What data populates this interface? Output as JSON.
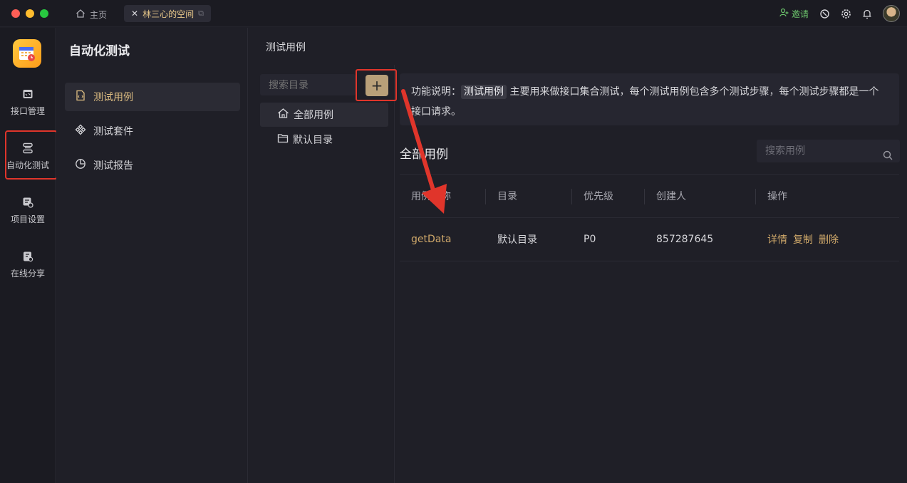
{
  "titlebar": {
    "home_tab": "主页",
    "active_tab": "林三心的空间",
    "invite_label": "邀请",
    "accent": "#e8c88a",
    "invite_color": "#6cc46c"
  },
  "rail": {
    "items": [
      {
        "label": "接口管理",
        "icon": "api-icon"
      },
      {
        "label": "自动化测试",
        "icon": "automation-icon"
      },
      {
        "label": "项目设置",
        "icon": "project-settings-icon"
      },
      {
        "label": "在线分享",
        "icon": "share-icon"
      }
    ]
  },
  "sidebar": {
    "title": "自动化测试",
    "items": [
      {
        "label": "测试用例",
        "icon": "test-case-icon"
      },
      {
        "label": "测试套件",
        "icon": "test-suite-icon"
      },
      {
        "label": "测试报告",
        "icon": "test-report-icon"
      }
    ]
  },
  "main": {
    "breadcrumb": "测试用例",
    "dir_search_placeholder": "搜索目录",
    "add_label": "+",
    "dirs": [
      {
        "label": "全部用例",
        "icon": "home-icon"
      },
      {
        "label": "默认目录",
        "icon": "folder-icon"
      }
    ],
    "note": {
      "prefix": "功能说明：",
      "tag": "测试用例",
      "text": " 主要用来做接口集合测试，每个测试用例包含多个测试步骤，每个测试步骤都是一个接口请求。"
    },
    "list_title": "全部用例",
    "case_search_placeholder": "搜索用例",
    "table": {
      "headers": [
        "用例名称",
        "目录",
        "优先级",
        "创建人",
        "操作"
      ],
      "rows": [
        {
          "name": "getData",
          "dir": "默认目录",
          "priority": "P0",
          "creator": "857287645",
          "ops": [
            "详情",
            "复制",
            "删除"
          ]
        }
      ]
    }
  },
  "annotation_color": "#e0352b"
}
